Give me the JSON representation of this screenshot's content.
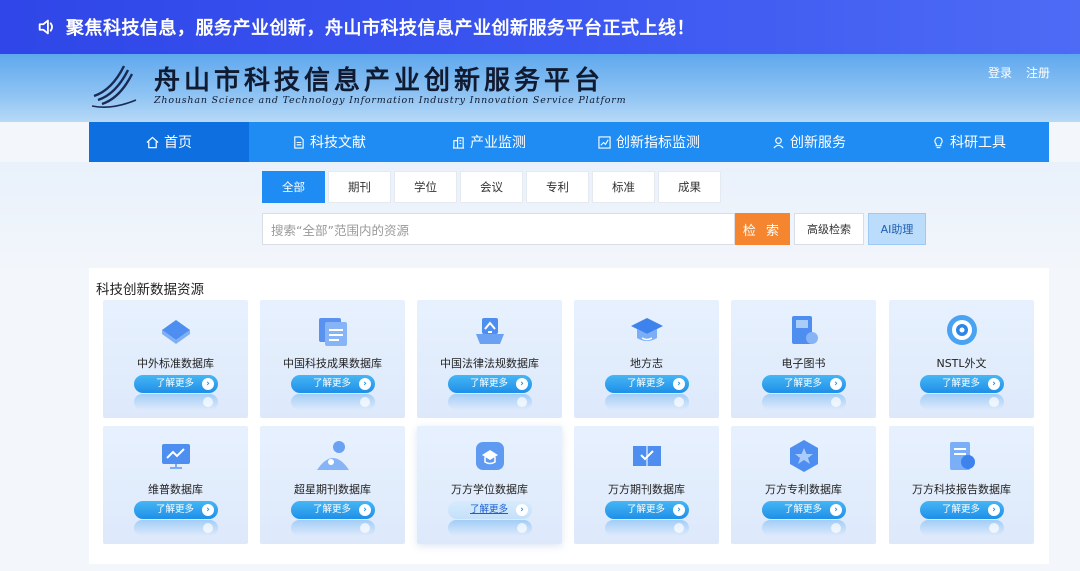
{
  "announcement": "聚焦科技信息，服务产业创新，舟山市科技信息产业创新服务平台正式上线！",
  "header": {
    "title_cn": "舟山市科技信息产业创新服务平台",
    "title_en": "Zhoushan Science and Technology Information Industry Innovation Service Platform",
    "login": "登录",
    "register": "注册"
  },
  "nav": [
    {
      "label": "首页",
      "icon": "home-icon",
      "active": true
    },
    {
      "label": "科技文献",
      "icon": "document-icon"
    },
    {
      "label": "产业监测",
      "icon": "building-icon"
    },
    {
      "label": "创新指标监测",
      "icon": "chart-icon"
    },
    {
      "label": "创新服务",
      "icon": "service-icon"
    },
    {
      "label": "科研工具",
      "icon": "bulb-icon"
    }
  ],
  "search": {
    "tabs": [
      "全部",
      "期刊",
      "学位",
      "会议",
      "专利",
      "标准",
      "成果"
    ],
    "active_tab": "全部",
    "placeholder": "搜索“全部”范围内的资源",
    "search_button": "检 索",
    "advanced_button": "高级检索",
    "ai_button": "AI助理"
  },
  "resources": {
    "title": "科技创新数据资源",
    "more_label": "了解更多",
    "items": [
      {
        "name": "中外标准数据库",
        "icon": "standard-db-icon"
      },
      {
        "name": "中国科技成果数据库",
        "icon": "achievement-db-icon"
      },
      {
        "name": "中国法律法规数据库",
        "icon": "law-db-icon"
      },
      {
        "name": "地方志",
        "icon": "gazetteer-icon"
      },
      {
        "name": "电子图书",
        "icon": "ebook-icon"
      },
      {
        "name": "NSTL外文",
        "icon": "nstl-icon"
      },
      {
        "name": "维普数据库",
        "icon": "vip-db-icon"
      },
      {
        "name": "超星期刊数据库",
        "icon": "chaoxing-icon"
      },
      {
        "name": "万方学位数据库",
        "icon": "wanfang-degree-icon"
      },
      {
        "name": "万方期刊数据库",
        "icon": "wanfang-journal-icon"
      },
      {
        "name": "万方专利数据库",
        "icon": "wanfang-patent-icon"
      },
      {
        "name": "万方科技报告数据库",
        "icon": "wanfang-report-icon"
      }
    ]
  },
  "colors": {
    "announce": "#3046e8",
    "nav": "#1e8cf3",
    "nav_active": "#0d6fe0",
    "search_button": "#f5862f",
    "card_bg": "#e7f1fe"
  }
}
